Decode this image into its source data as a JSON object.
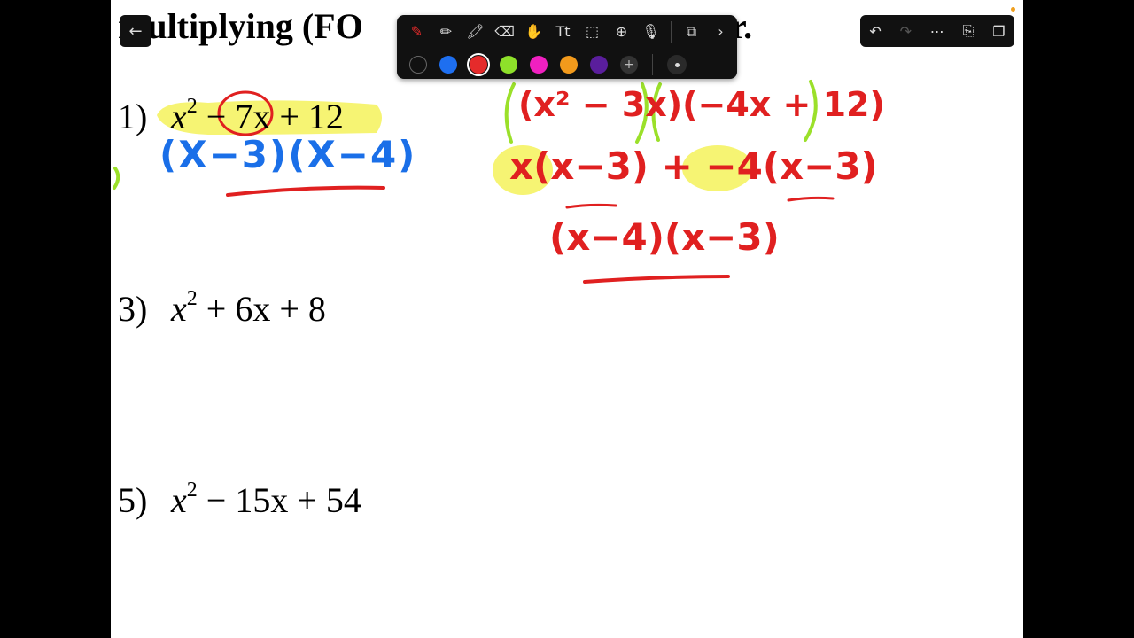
{
  "document": {
    "title_left": "multiplying (FO",
    "title_right": "r.",
    "problems": [
      {
        "num": "1)",
        "expr_base": "x",
        "expr_exp": "2",
        "expr_rest": " − 7x + 12"
      },
      {
        "num": "3)",
        "expr_base": "x",
        "expr_exp": "2",
        "expr_rest": " + 6x + 8"
      },
      {
        "num": "5)",
        "expr_base": "x",
        "expr_exp": "2",
        "expr_rest": " − 15x + 54"
      }
    ]
  },
  "handwriting": {
    "blue_answer": "(X−3)(X−4)",
    "red_line1": "(x² − 3x)(−4x + 12)",
    "red_line2": "x(x−3) + −4(x−3)",
    "red_line3": "(x−4)(x−3)"
  },
  "toolbar": {
    "tools": [
      "pen-icon",
      "pencil-icon",
      "highlighter-icon",
      "eraser-icon",
      "lasso-icon",
      "text-icon",
      "selection-icon",
      "add-icon",
      "microphone-icon",
      "shape-icon",
      "chevron-right-icon"
    ],
    "colors": [
      "#111111",
      "#1e6ff0",
      "#e52b2b",
      "#8ee02a",
      "#f020c0",
      "#f29a1c",
      "#5a1e9c"
    ],
    "selected_color": "#e52b2b"
  },
  "colors": {
    "ink_red": "#e02020",
    "ink_blue": "#1a6fe8",
    "highlight_yellow": "#f4f25a",
    "ink_green": "#9be02a"
  }
}
